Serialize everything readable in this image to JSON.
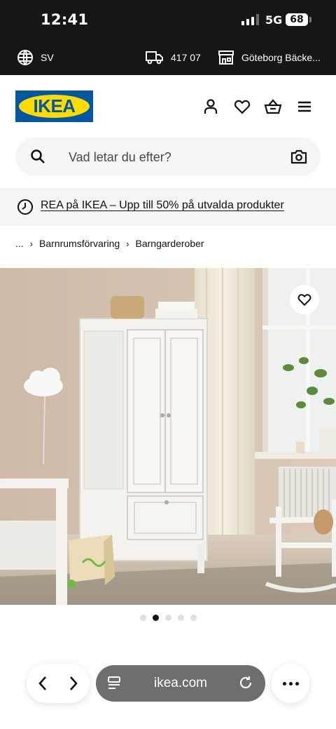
{
  "status_bar": {
    "time": "12:41",
    "network": "5G",
    "battery": "68"
  },
  "utility_bar": {
    "language": "SV",
    "postal_code": "417 07",
    "store": "Göteborg Bäcke..."
  },
  "header": {
    "logo_text": "IKEA",
    "colors": {
      "logo_blue": "#0058a3",
      "logo_yellow": "#ffdb00"
    },
    "icons": [
      "profile-icon",
      "heart-icon",
      "basket-icon",
      "menu-icon"
    ]
  },
  "search": {
    "placeholder": "Vad letar du efter?"
  },
  "promo": {
    "text": "REA på IKEA – Upp till 50% på utvalda produkter"
  },
  "breadcrumb": {
    "ellipsis": "...",
    "items": [
      "Barnrumsförvaring",
      "Barngarderober"
    ]
  },
  "gallery": {
    "total_images": 5,
    "active_index": 1
  },
  "browser": {
    "url": "ikea.com"
  }
}
